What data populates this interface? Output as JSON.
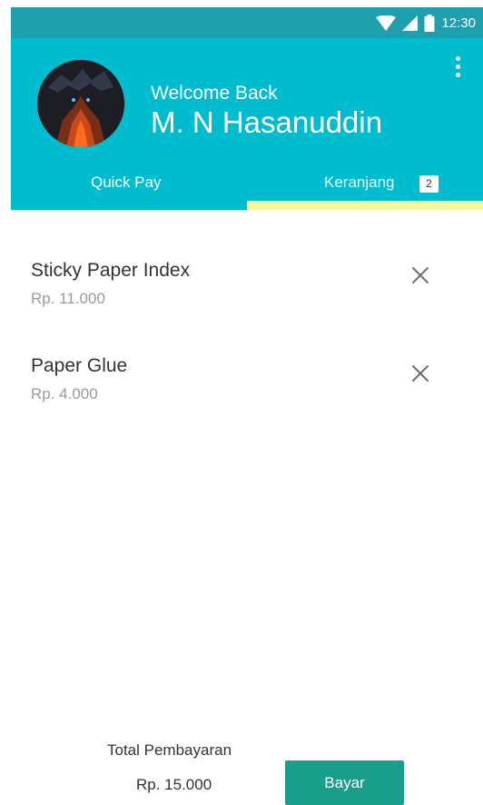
{
  "status_bar": {
    "time": "12:30",
    "icons": [
      "wifi-icon",
      "signal-icon",
      "battery-icon"
    ],
    "background": "#1f9fad"
  },
  "header": {
    "welcome": "Welcome Back",
    "user_name": "M. N Hasanuddin",
    "background": "#00bccf",
    "menu_icon": "more-vert-icon",
    "tabs": [
      {
        "label": "Quick Pay",
        "selected": false
      },
      {
        "label": "Keranjang",
        "badge": "2",
        "selected": true
      }
    ],
    "tab_indicator_color": "#f4f79a"
  },
  "cart": {
    "items": [
      {
        "name": "Sticky Paper Index",
        "price": "Rp. 11.000",
        "remove_icon": "close-icon"
      },
      {
        "name": "Paper Glue",
        "price": "Rp. 4.000",
        "remove_icon": "close-icon"
      }
    ]
  },
  "footer": {
    "total_label": "Total Pembayaran",
    "total_amount": "Rp. 15.000",
    "pay_label": "Bayar",
    "pay_color": "#1a9e8c"
  }
}
